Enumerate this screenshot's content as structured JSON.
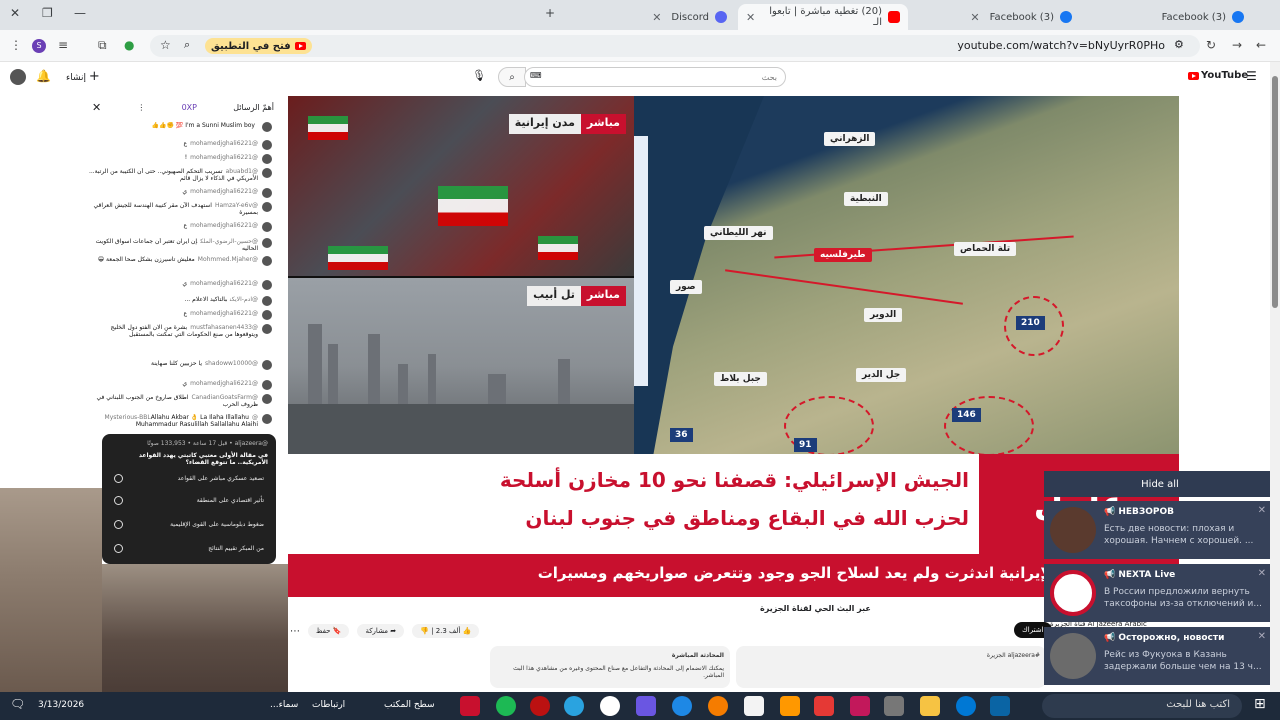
{
  "tabs": [
    {
      "label": "Discord",
      "active": false
    },
    {
      "label": "(20) تغطية مباشرة | تابعوا الـ",
      "active": true
    },
    {
      "label": "(3) Facebook",
      "active": false
    },
    {
      "label": "(3) Facebook",
      "active": false
    }
  ],
  "toolbar": {
    "open_app_label": "فتح في التطبيق",
    "url": "youtube.com/watch?v=bNyUyrR0PHo"
  },
  "yt_header": {
    "search_placeholder": "بحث",
    "create_label": "إنشاء",
    "logo": "YouTube"
  },
  "chat": {
    "header_title": "أهمّ الرسائل",
    "tab_label": "0XP",
    "messages": [
      {
        "author": "",
        "text": "I'm a Sunni Muslim boy 💯 ✊👍👍"
      },
      {
        "author": "@mohamedjghali6221",
        "text": "ع"
      },
      {
        "author": "@mohamedjghali6221",
        "text": "!"
      },
      {
        "author": "@abuabd1",
        "text": "تسريب التحكم الصهيوني.. حتى أن الكتيبة من الرتبة... الأمريكي في الذكاء لا يزال قائم"
      },
      {
        "author": "@mohamedjghali6221",
        "text": "ي"
      },
      {
        "author": "@HamzaY-e6v",
        "text": "استهدف الآن مقر كتيبة الهندسة للجيش العراقي بمسيرة"
      },
      {
        "author": "@mohamedjghali6221",
        "text": "ع"
      },
      {
        "author": "@حسين-الرضوي-الملك",
        "text": "إن ايران تعتبر أن جماعات اسواق الكويت الحاليه"
      },
      {
        "author": "@Mohmmed.Mjaher",
        "text": "معليش تاسيرزن بشكل صحا الجمعة 😁"
      },
      {
        "author": "@mohamedjghali6221",
        "text": "ي"
      },
      {
        "author": "@ادم-الايكن",
        "text": "بالتاكيد الاعلام ..."
      },
      {
        "author": "@mohamedjghali6221",
        "text": "ع"
      },
      {
        "author": "@mustfahasanen4433",
        "text": "بشرة من الان الفتو دول الخليج ويتوقعوها من صنع الحكومات التي تمكنت بالمستقبل"
      },
      {
        "author": "@shadoww10000",
        "text": "يا حزبيين كلنا صهاينة"
      },
      {
        "author": "@mohamedjghali6221",
        "text": "ي"
      },
      {
        "author": "@CanadianGoatsFarm",
        "text": "اطلاق صاروخ من الجنوب اللبناني في ظروف الحرب"
      },
      {
        "author": "@Mysterious-BBL",
        "text": "Allahu Akbar 👌 La Ilaha Illallahu Muhammadur Rasulillah Sallallahu Alaihi"
      }
    ],
    "poll": {
      "meta": "@aljazeera • قبل 17 ساعة • 133,953 صوتًا",
      "question": "في مقالة الأولى معتبي كاتبتي يهدد القواعد الأمريكية.. ما تتوقع القضاء؟",
      "options": [
        "تصعيد عسكري مباشر على القواعد",
        "تأثير اقتصادي على المنطقة",
        "ضغوط دبلوماسية على القوى الإقليمية",
        "من المبكر تقييم النتائج"
      ]
    }
  },
  "video": {
    "feed1_tag_live": "مباشر",
    "feed1_tag_place": "مدن إيرانية",
    "feed2_tag_live": "مباشر",
    "feed2_tag_place": "تل أبيب",
    "map_labels": [
      "الزهراني",
      "النبطية",
      "نهر الليطاني",
      "طيرفلسيه",
      "تلة الحماص",
      "صور",
      "الدوير",
      "جبل بلاط",
      "جل الدير"
    ],
    "map_numbers": [
      "210",
      "146",
      "36",
      "91"
    ],
    "breaking": "عاجل",
    "headline_line1": "الجيش الإسرائيلي: قصفنا نحو 10 مخازن أسلحة",
    "headline_line2": "لحزب الله في البقاع ومناطق في جنوب لبنان",
    "crawl": "ترمب: البحرية الإيرانية اندثرت ولم يعد لسلاح الجو وجود وتتعرض صواريخهم ومسيرات"
  },
  "below_video": {
    "title": "عبر البث الحي لقناة الجزيرة",
    "channel": "Al Jazeera Arabic قناة الجزيرة",
    "subscribe": "اشتراك",
    "likes": "2.3 ألف",
    "share": "مشاركة",
    "save": "حفظ",
    "desc_left_title": "المحادثة المباشرة",
    "desc_left_text": "يمكنك الانضمام إلى المحادثة والتفاعل مع صناع المحتوى وغيره من مشاهدي هذا البث المباشر.",
    "desc_right_text": "#aljazeera الجزيرة"
  },
  "notifications": {
    "hide_all": "Hide all",
    "items": [
      {
        "title": "📢 НЕВЗОРОВ",
        "body": "Есть две новости: плохая и хорошая.  Начнем с хорошей. ...",
        "color": "#5a3a2e"
      },
      {
        "title": "📢 NEXTA Live",
        "body": "В России предложили вернуть таксофоны из-за отключений и...",
        "color": "#ffffff"
      },
      {
        "title": "📢 Осторожно, новости",
        "body": "Рейс из Фукуока в Казань задержали больше чем на 13 ч...",
        "color": "#6b6b6b"
      }
    ]
  },
  "taskbar": {
    "search_placeholder": "اكتب هنا للبحث",
    "desktop_label": "سطح المكتب",
    "links_label": "ارتباطات",
    "date": "3/13/2026",
    "clock_label": "سماء..."
  }
}
